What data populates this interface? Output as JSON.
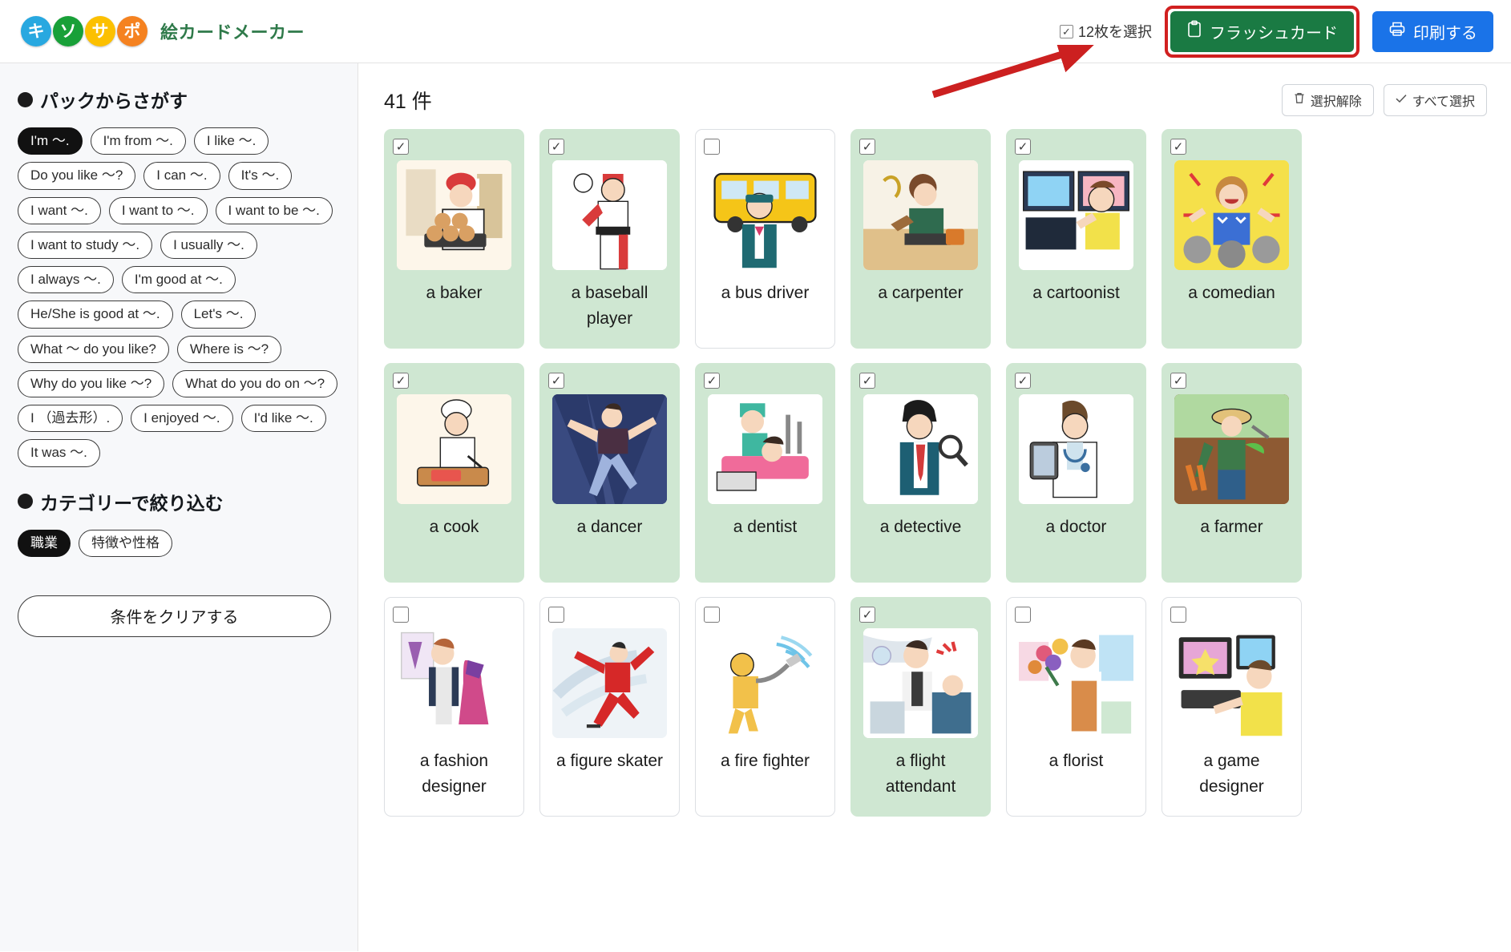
{
  "header": {
    "logo_letters": [
      {
        "char": "キ",
        "color": "#28a8e0"
      },
      {
        "char": "ソ",
        "color": "#18a038"
      },
      {
        "char": "サ",
        "color": "#fcc000"
      },
      {
        "char": "ポ",
        "color": "#f58220"
      }
    ],
    "app_title": "絵カードメーカー",
    "selection_label": "12枚を選択",
    "flashcard_button": "フラッシュカード",
    "print_button": "印刷する",
    "accent_green": "#1a7a43",
    "accent_blue": "#1a73e8",
    "highlight_red": "#d12020"
  },
  "sidebar": {
    "pack_heading": "パックからさがす",
    "pack_chips": [
      {
        "label": "I'm 〜.",
        "active": true
      },
      {
        "label": "I'm from 〜.",
        "active": false
      },
      {
        "label": "I like 〜.",
        "active": false
      },
      {
        "label": "Do you like 〜?",
        "active": false
      },
      {
        "label": "I can 〜.",
        "active": false
      },
      {
        "label": "It's 〜.",
        "active": false
      },
      {
        "label": "I want 〜.",
        "active": false
      },
      {
        "label": "I want to 〜.",
        "active": false
      },
      {
        "label": "I want to be 〜.",
        "active": false
      },
      {
        "label": "I want to study 〜.",
        "active": false
      },
      {
        "label": "I usually 〜.",
        "active": false
      },
      {
        "label": "I always 〜.",
        "active": false
      },
      {
        "label": "I'm good at 〜.",
        "active": false
      },
      {
        "label": "He/She is good at 〜.",
        "active": false
      },
      {
        "label": "Let's 〜.",
        "active": false
      },
      {
        "label": "What 〜 do you like?",
        "active": false
      },
      {
        "label": "Where is 〜?",
        "active": false
      },
      {
        "label": "Why do you like 〜?",
        "active": false
      },
      {
        "label": "What do you do on 〜?",
        "active": false
      },
      {
        "label": "I （過去形）.",
        "active": false
      },
      {
        "label": "I enjoyed 〜.",
        "active": false
      },
      {
        "label": "I'd like 〜.",
        "active": false
      },
      {
        "label": "It was 〜.",
        "active": false
      }
    ],
    "category_heading": "カテゴリーで絞り込む",
    "category_chips": [
      {
        "label": "職業",
        "active": true
      },
      {
        "label": "特徴や性格",
        "active": false
      }
    ],
    "clear_button": "条件をクリアする"
  },
  "main": {
    "count_label": "41 件",
    "deselect_button": "選択解除",
    "select_all_button": "すべて選択",
    "cards": [
      {
        "label": "a baker",
        "selected": true,
        "art": "baker"
      },
      {
        "label": "a baseball player",
        "selected": true,
        "art": "baseball"
      },
      {
        "label": "a bus driver",
        "selected": false,
        "art": "bus"
      },
      {
        "label": "a carpenter",
        "selected": true,
        "art": "carpenter"
      },
      {
        "label": "a cartoonist",
        "selected": true,
        "art": "cartoonist"
      },
      {
        "label": "a comedian",
        "selected": true,
        "art": "comedian"
      },
      {
        "label": "a cook",
        "selected": true,
        "art": "cook"
      },
      {
        "label": "a dancer",
        "selected": true,
        "art": "dancer"
      },
      {
        "label": "a dentist",
        "selected": true,
        "art": "dentist"
      },
      {
        "label": "a detective",
        "selected": true,
        "art": "detective"
      },
      {
        "label": "a doctor",
        "selected": true,
        "art": "doctor"
      },
      {
        "label": "a farmer",
        "selected": true,
        "art": "farmer"
      },
      {
        "label": "a fashion designer",
        "selected": false,
        "art": "fashion"
      },
      {
        "label": "a figure skater",
        "selected": false,
        "art": "skater"
      },
      {
        "label": "a fire fighter",
        "selected": false,
        "art": "firefighter"
      },
      {
        "label": "a flight attendant",
        "selected": true,
        "art": "flight"
      },
      {
        "label": "a florist",
        "selected": false,
        "art": "florist"
      },
      {
        "label": "a game designer",
        "selected": false,
        "art": "gamedesigner"
      }
    ]
  }
}
